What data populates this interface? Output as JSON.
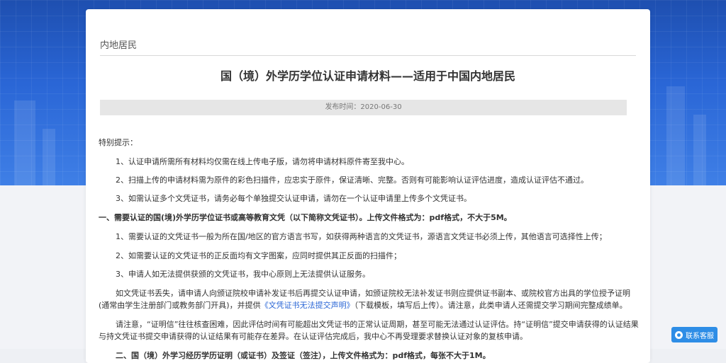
{
  "breadcrumb": "内地居民",
  "title": "国（境）外学历学位认证申请材料——适用于中国内地居民",
  "publish": "发布时间：2020-06-30",
  "notice_label": "特别提示：",
  "notices": [
    "1、认证申请所需所有材料均仅需在线上传电子版，请勿将申请材料原件寄至我中心。",
    "2、扫描上传的申请材料需为原件的彩色扫描件，应忠实于原件，保证清晰、完整。否则有可能影响认证评估进度，造成认证评估不通过。",
    "3、如需认证多个文凭证书，请务必每个单独提交认证申请，请勿在一个认证申请里上传多个文凭证书。"
  ],
  "section1_heading": "一、需要认证的国(境)外学历学位证书或高等教育文凭（以下简称文凭证书）。上传文件格式为：pdf格式，不大于5M。",
  "section1_items": [
    "1、需要认证的文凭证书一般为所在国/地区的官方语言书写，如获得两种语言的文凭证书，源语言文凭证书必须上传，其他语言可选择性上传；",
    "2、如需要认证的文凭证书的正反面均有文字图案，应同时提供其正反面的扫描件；",
    "3、申请人如无法提供获颁的文凭证书，我中心原则上无法提供认证服务。"
  ],
  "para_lost_1": "如文凭证书丢失，请申请人向颁证院校申请补发证书后再提交认证申请，如颁证院校无法补发证书则应提供证书副本、或院校官方出具的学位授予证明",
  "para_lost_2a": "(通常由学生注册部门或教务部门开具)，并提供",
  "para_lost_link": "《文凭证书无法提交声明》",
  "para_lost_2b": "（下载模板，填写后上传）。请注意，此类申请人还需提交学习期间完整成绩单。",
  "para_note_1": "请注意，“证明信”往往核查困难，因此评估时间有可能超出文凭证书的正常认证周期，甚至可能无法通过认证评估。持“证明信”提交申请获得的认证结果",
  "para_note_2": "与持文凭证书提交申请获得的认证结果有可能存在差异。在认证评估完成后，我中心不再受理要求替换认证对象的复核申请。",
  "section2_partial": "二、国（境）外学习经历学历证明（或证书）及签证（签注），上传文件格式为：pdf格式，每张不大于1M。",
  "service_label": "联系客服"
}
